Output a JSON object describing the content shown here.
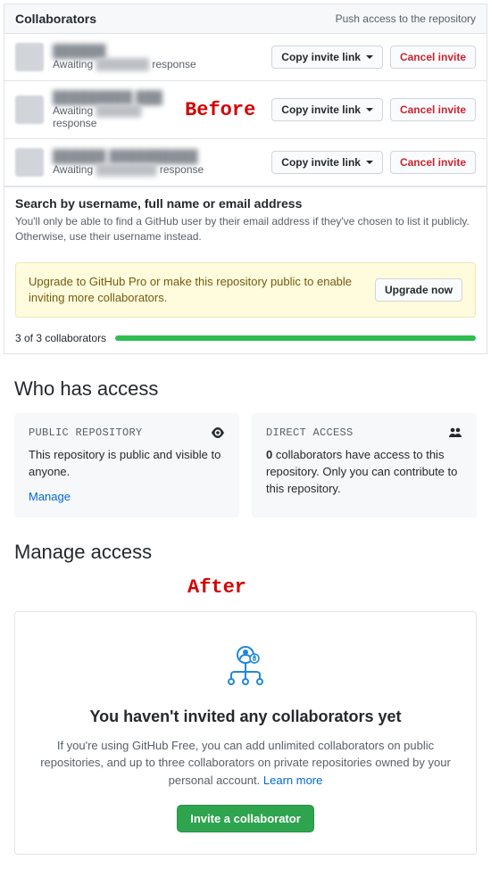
{
  "annotations": {
    "before": "Before",
    "after": "After"
  },
  "collab_panel": {
    "title": "Collaborators",
    "subtitle": "Push access to the repository",
    "copy_btn": "Copy invite link",
    "cancel_btn": "Cancel invite",
    "rows": [
      {
        "name": "██████",
        "await_pre": "Awaiting ",
        "await_blur": "███████",
        "await_post": " response"
      },
      {
        "name": "█████████ ███",
        "await_pre": "Awaiting ",
        "await_blur": "██████",
        "await_post": " response"
      },
      {
        "name": "██████ ██████████",
        "await_pre": "Awaiting ",
        "await_blur": "████████",
        "await_post": " response"
      }
    ],
    "search_title": "Search by username, full name or email address",
    "search_desc": "You'll only be able to find a GitHub user by their email address if they've chosen to list it publicly. Otherwise, use their username instead.",
    "banner_text": "Upgrade to GitHub Pro or make this repository public to enable inviting more collaborators.",
    "upgrade_btn": "Upgrade now",
    "progress_label": "3 of 3 collaborators"
  },
  "access": {
    "heading": "Who has access",
    "public": {
      "label": "PUBLIC REPOSITORY",
      "body": "This repository is public and visible to anyone.",
      "link": "Manage"
    },
    "direct": {
      "label": "DIRECT ACCESS",
      "body_strong": "0",
      "body_rest": " collaborators have access to this repository. Only you can contribute to this repository."
    }
  },
  "manage": {
    "heading": "Manage access",
    "empty_title": "You haven't invited any collaborators yet",
    "empty_desc": "If you're using GitHub Free, you can add unlimited collaborators on public repositories, and up to three collaborators on private repositories owned by your personal account. ",
    "learn_more": "Learn more",
    "invite_btn": "Invite a collaborator"
  }
}
